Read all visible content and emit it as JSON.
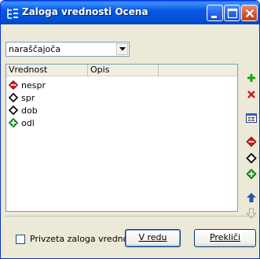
{
  "window": {
    "title": "Zaloga vrednosti Ocena",
    "title_icon": "tree-structure-icon"
  },
  "sort_combo": {
    "value": "naraščajoča",
    "arrow_icon": "chevron-down-icon"
  },
  "list": {
    "columns": [
      "Vrednost",
      "Opis"
    ],
    "rows": [
      {
        "value": "nespr",
        "icon": "diamond-red-icon"
      },
      {
        "value": "spr",
        "icon": "diamond-outline-icon"
      },
      {
        "value": "dob",
        "icon": "diamond-outline-icon"
      },
      {
        "value": "odl",
        "icon": "diamond-green-icon"
      }
    ]
  },
  "side_toolbar": [
    "add-icon",
    "delete-icon",
    "properties-icon",
    "diamond-red-icon",
    "diamond-outline-icon",
    "diamond-green-icon",
    "move-up-icon",
    "move-down-icon"
  ],
  "footer": {
    "checkbox_label": "Privzeta zaloga vrednosti",
    "checkbox_checked": false,
    "ok_label": "V redu",
    "cancel_label": "Prekliči"
  },
  "colors": {
    "titlebar": "#0553d8",
    "dialog_bg": "#ece9d8",
    "accent_green": "#1aa31a",
    "accent_red": "#cc1f1f"
  }
}
